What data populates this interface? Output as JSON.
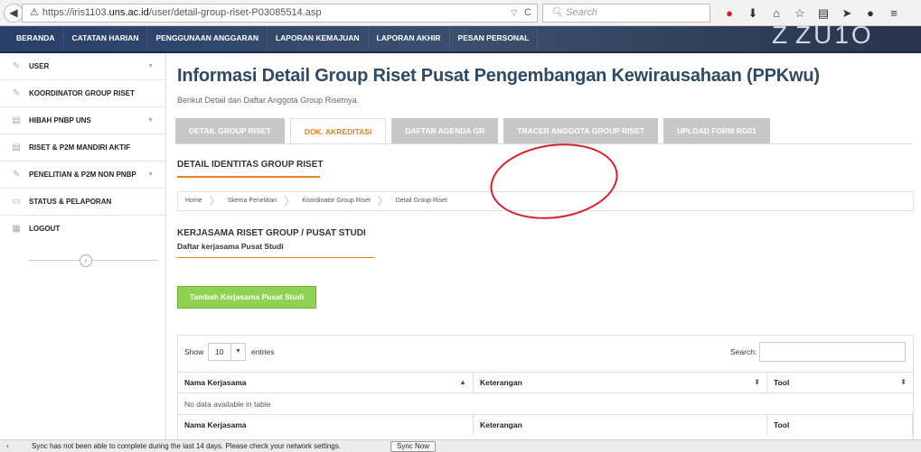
{
  "browser": {
    "url_prefix": "https://iris1103.",
    "url_host": "uns.ac.id",
    "url_path": "/user/detail-group-riset-P03085514.asp",
    "search_placeholder": "Search",
    "icons": [
      "record-icon",
      "download-icon",
      "home-icon",
      "star-icon",
      "bookmark-list-icon",
      "send-icon",
      "chat-icon",
      "menu-icon"
    ]
  },
  "nav": {
    "items": [
      "BERANDA",
      "CATATAN HARIAN",
      "PENGGUNAAN ANGGARAN",
      "LAPORAN KEMAJUAN",
      "LAPORAN AKHIR",
      "PESAN PERSONAL"
    ],
    "year_left": "Z",
    "year_right": "ZU1O"
  },
  "sidebar": {
    "items": [
      {
        "label": "USER",
        "has_arrow": true
      },
      {
        "label": "KOORDINATOR GROUP RISET",
        "has_arrow": false
      },
      {
        "label": "HIBAH PNBP UNS",
        "has_arrow": true
      },
      {
        "label": "RISET & P2M MANDIRI AKTIF",
        "has_arrow": false
      },
      {
        "label": "PENELITIAN & P2M NON PNBP",
        "has_arrow": true
      },
      {
        "label": "STATUS & PELAPORAN",
        "has_arrow": false
      },
      {
        "label": "LOGOUT",
        "has_arrow": false
      }
    ],
    "collapse_glyph": "‹"
  },
  "main": {
    "title": "Informasi Detail Group Riset Pusat Pengembangan Kewirausahaan (PPKwu)",
    "subtitle": "Berikut Detail dan Daftar Anggota Group Risetnya.",
    "tabs": [
      "DETAIL GROUP RISET",
      "DOK. AKREDITASI",
      "DAFTAR AGENDA GR",
      "TRACER ANGGOTA GROUP RISET",
      "UPLOAD FORM RG01"
    ],
    "active_tab": 1,
    "section_heading": "DETAIL IDENTITAS GROUP RISET",
    "breadcrumb": [
      "Home",
      "Skema Penelitian",
      "Koordinator Group Riset",
      "Detail Group Riset"
    ],
    "sub_heading": "KERJASAMA RISET GROUP / PUSAT STUDI",
    "sub_heading2": "Daftar kerjasama Pusat Studi",
    "add_button": "Tambah Kerjasama Pusat Studi",
    "table": {
      "show_label": "Show",
      "show_value": "10",
      "entries_label": "entries",
      "search_label": "Search:",
      "columns": [
        "Nama Kerjasama",
        "Keterangan",
        "Tool"
      ],
      "empty_text": "No data available in table"
    }
  },
  "notification": {
    "text": "Sync has not been able to complete during the last 14 days. Please check your network settings.",
    "button": "Sync Now"
  }
}
